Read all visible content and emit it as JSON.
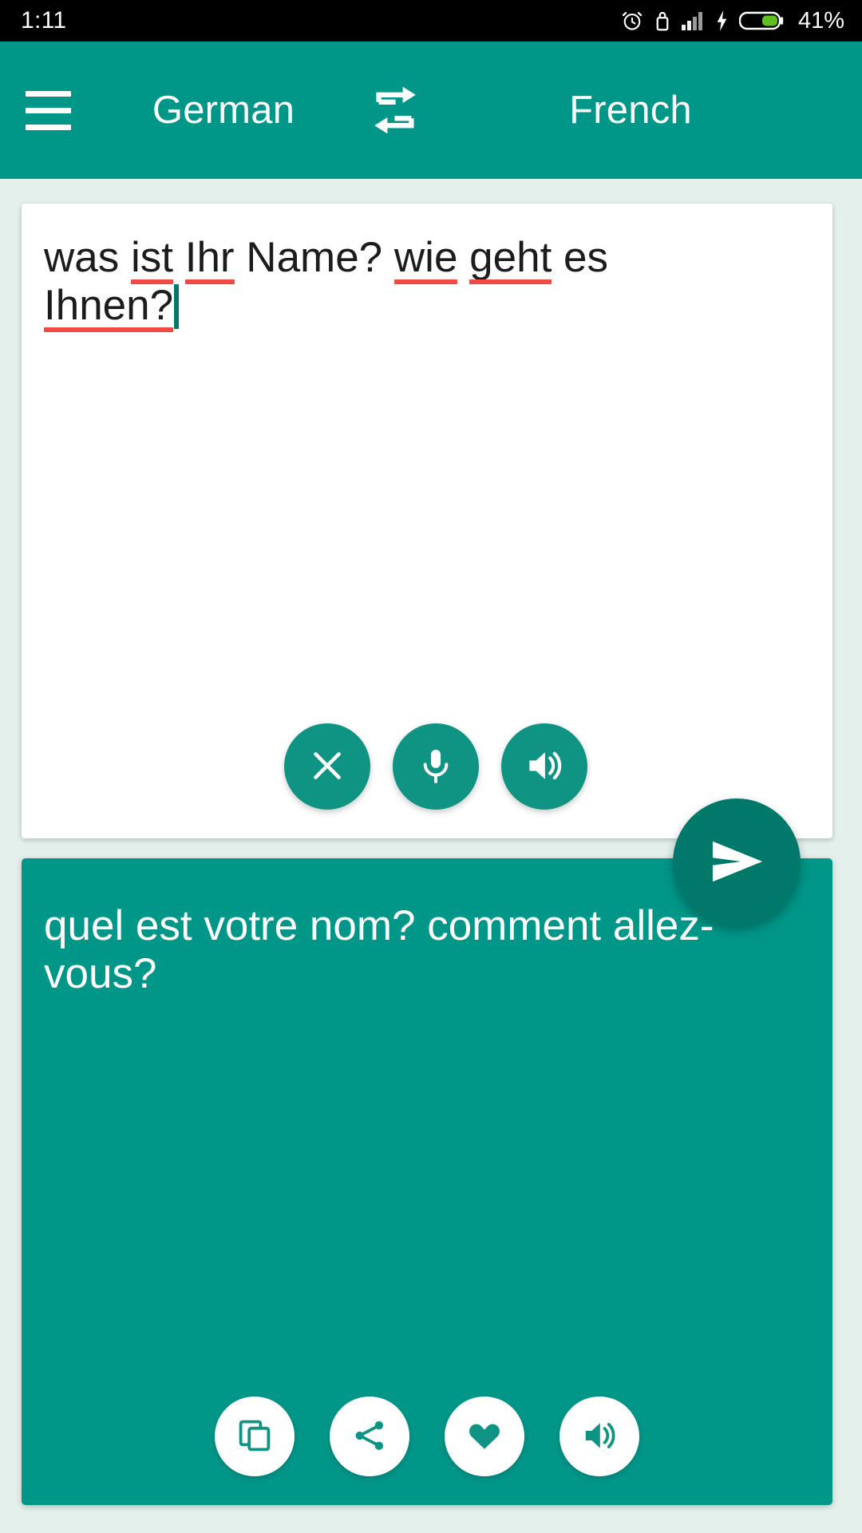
{
  "status_bar": {
    "time": "1:11",
    "battery_percent": "41%",
    "icons": [
      "alarm-icon",
      "lock-icon",
      "signal-bars-icon",
      "charging-bolt-icon",
      "battery-icon"
    ]
  },
  "toolbar": {
    "menu_icon": "hamburger-menu-icon",
    "source_language": "German",
    "swap_icon": "swap-languages-icon",
    "target_language": "French",
    "background_color": "#009688"
  },
  "source_card": {
    "text_lines": [
      "was ist Ihr Name? wie geht es",
      "Ihnen?"
    ],
    "full_text": "was ist Ihr Name? wie geht es Ihnen?",
    "misspelled_words": [
      "ist",
      "Ihr",
      "wie",
      "geht",
      "Ihnen"
    ],
    "spellcheck_underline_color": "#ef4b44",
    "caret_color": "#00796b",
    "caret_visible": true,
    "background_color": "#ffffff",
    "actions": [
      {
        "name": "clear-button",
        "icon": "close-x-icon",
        "label": "Clear"
      },
      {
        "name": "voice-input-button",
        "icon": "microphone-icon",
        "label": "Speak"
      },
      {
        "name": "speak-source-button",
        "icon": "speaker-volume-icon",
        "label": "Listen"
      }
    ]
  },
  "send_button": {
    "name": "translate-send-button",
    "icon": "send-paper-plane-icon",
    "color": "#00796b"
  },
  "result_card": {
    "text_lines": [
      "quel est votre nom? comment allez-",
      "vous?"
    ],
    "full_text": "quel est votre nom? comment allez-vous?",
    "background_color": "#009688",
    "text_color": "#ffffff",
    "actions": [
      {
        "name": "copy-button",
        "icon": "copy-icon",
        "label": "Copy"
      },
      {
        "name": "share-button",
        "icon": "share-icon",
        "label": "Share"
      },
      {
        "name": "favorite-button",
        "icon": "heart-icon",
        "label": "Favorite"
      },
      {
        "name": "speak-result-button",
        "icon": "speaker-volume-icon",
        "label": "Listen"
      }
    ]
  },
  "page": {
    "background_color": "#e4f0ec"
  }
}
